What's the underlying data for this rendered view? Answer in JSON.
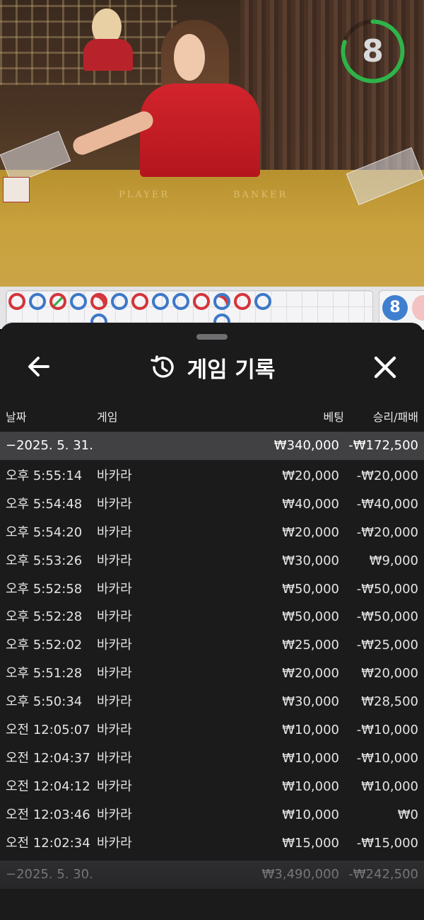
{
  "video": {
    "felt_player": "PLAYER",
    "felt_banker": "BANKER",
    "countdown": "8",
    "countdown_fraction": 0.8
  },
  "road": {
    "side_badge": "8",
    "beads": [
      {
        "color": "red"
      },
      {
        "color": "blue"
      },
      {
        "color": "red",
        "tie": true
      },
      {
        "color": "blue"
      },
      {
        "color": "red",
        "dot": true
      },
      {
        "color": "blue"
      },
      {
        "color": "red"
      },
      {
        "color": "blue"
      },
      {
        "color": "blue"
      },
      {
        "color": "red"
      },
      {
        "color": "blue",
        "dot": true
      },
      {
        "color": "red"
      },
      {
        "color": "blue"
      }
    ]
  },
  "panel": {
    "title": "게임 기록",
    "columns": {
      "date": "날짜",
      "game": "게임",
      "bet": "베팅",
      "result": "승리/패배"
    },
    "day1": {
      "date": "−2025. 5. 31.",
      "bet": "₩340,000",
      "result": "-₩172,500"
    },
    "rows": [
      {
        "time": "오후 5:55:14",
        "game": "바카라",
        "bet": "₩20,000",
        "result": "-₩20,000"
      },
      {
        "time": "오후 5:54:48",
        "game": "바카라",
        "bet": "₩40,000",
        "result": "-₩40,000"
      },
      {
        "time": "오후 5:54:20",
        "game": "바카라",
        "bet": "₩20,000",
        "result": "-₩20,000"
      },
      {
        "time": "오후 5:53:26",
        "game": "바카라",
        "bet": "₩30,000",
        "result": "₩9,000"
      },
      {
        "time": "오후 5:52:58",
        "game": "바카라",
        "bet": "₩50,000",
        "result": "-₩50,000"
      },
      {
        "time": "오후 5:52:28",
        "game": "바카라",
        "bet": "₩50,000",
        "result": "-₩50,000"
      },
      {
        "time": "오후 5:52:02",
        "game": "바카라",
        "bet": "₩25,000",
        "result": "-₩25,000"
      },
      {
        "time": "오후 5:51:28",
        "game": "바카라",
        "bet": "₩20,000",
        "result": "₩20,000"
      },
      {
        "time": "오후 5:50:34",
        "game": "바카라",
        "bet": "₩30,000",
        "result": "₩28,500"
      },
      {
        "time": "오전 12:05:07",
        "game": "바카라",
        "bet": "₩10,000",
        "result": "-₩10,000"
      },
      {
        "time": "오전 12:04:37",
        "game": "바카라",
        "bet": "₩10,000",
        "result": "-₩10,000"
      },
      {
        "time": "오전 12:04:12",
        "game": "바카라",
        "bet": "₩10,000",
        "result": "₩10,000"
      },
      {
        "time": "오전 12:03:46",
        "game": "바카라",
        "bet": "₩10,000",
        "result": "₩0"
      },
      {
        "time": "오전 12:02:34",
        "game": "바카라",
        "bet": "₩15,000",
        "result": "-₩15,000"
      }
    ],
    "day2": {
      "date": "−2025. 5. 30.",
      "bet": "₩3,490,000",
      "result": "-₩242,500"
    }
  },
  "colors": {
    "red": "#d4343a",
    "blue": "#3c78c8",
    "green": "#2fb34a",
    "panel": "#1b1b1c",
    "day_row": "#414143"
  }
}
